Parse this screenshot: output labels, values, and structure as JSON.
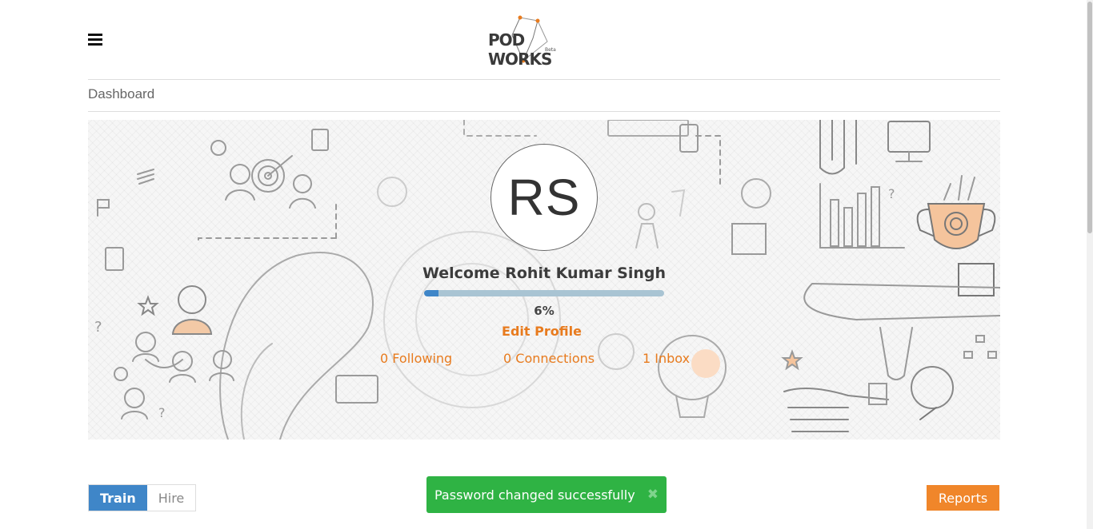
{
  "header": {
    "logo_text": "POD WORKS",
    "logo_badge": "Beta",
    "menu_icon": "hamburger-icon"
  },
  "breadcrumb": "Dashboard",
  "profile": {
    "initials": "RS",
    "welcome": "Welcome Rohit Kumar Singh",
    "progress_percent": 6,
    "progress_label": "6%",
    "edit_profile": "Edit Profile"
  },
  "stats": {
    "following": "0 Following",
    "connections": "0 Connections",
    "inbox": "1 Inbox"
  },
  "tabs": [
    {
      "label": "Train",
      "active": true
    },
    {
      "label": "Hire",
      "active": false
    }
  ],
  "toast": {
    "message": "Password changed successfully",
    "close_icon": "close-icon"
  },
  "reports_button": "Reports",
  "colors": {
    "accent_orange": "#e87b1e",
    "primary_blue": "#3f86c8",
    "success_green": "#2fb344",
    "reports_orange": "#f0862a"
  }
}
